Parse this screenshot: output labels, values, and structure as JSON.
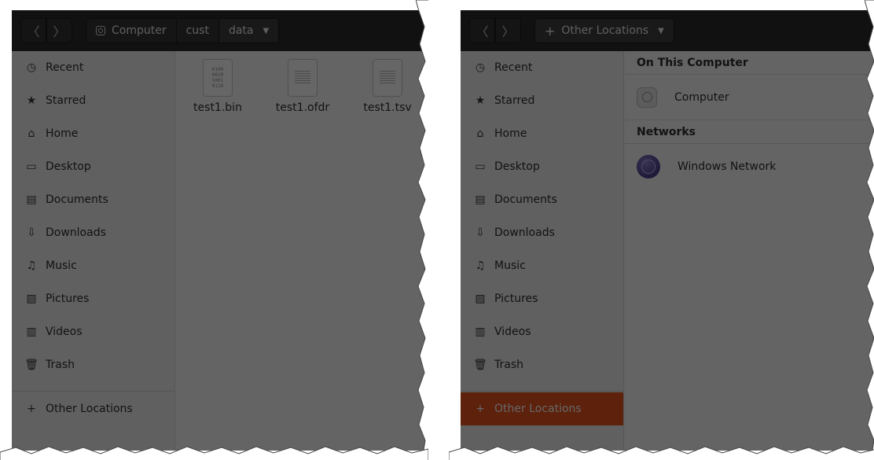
{
  "left": {
    "nav": {
      "back_glyph": "〈",
      "forward_glyph": "〉"
    },
    "breadcrumbs": [
      {
        "label": "Computer",
        "icon": "drive-icon"
      },
      {
        "label": "cust"
      },
      {
        "label": "data",
        "dropdown": true
      }
    ],
    "sidebar": {
      "items": [
        {
          "label": "Recent",
          "icon": "clock-icon",
          "glyph": "◷"
        },
        {
          "label": "Starred",
          "icon": "star-icon",
          "glyph": "★"
        },
        {
          "label": "Home",
          "icon": "home-icon",
          "glyph": "⌂"
        },
        {
          "label": "Desktop",
          "icon": "desktop-icon",
          "glyph": "▭"
        },
        {
          "label": "Documents",
          "icon": "document-icon",
          "glyph": "▤"
        },
        {
          "label": "Downloads",
          "icon": "download-icon",
          "glyph": "⇩"
        },
        {
          "label": "Music",
          "icon": "music-icon",
          "glyph": "♫"
        },
        {
          "label": "Pictures",
          "icon": "picture-icon",
          "glyph": "▨"
        },
        {
          "label": "Videos",
          "icon": "video-icon",
          "glyph": "▥"
        },
        {
          "label": "Trash",
          "icon": "trash-icon",
          "glyph": "🗑"
        }
      ],
      "other_locations": {
        "label": "Other Locations",
        "glyph": "+"
      }
    },
    "files": [
      {
        "name": "test1.bin",
        "type": "binary",
        "icon_text": "0100\n0010\n1001\n0110"
      },
      {
        "name": "test1.ofdr",
        "type": "text"
      },
      {
        "name": "test1.tsv",
        "type": "text"
      }
    ]
  },
  "right": {
    "nav": {
      "back_glyph": "〈",
      "forward_glyph": "〉"
    },
    "location_button": {
      "label": "Other Locations",
      "glyph": "+"
    },
    "sidebar": {
      "items": [
        {
          "label": "Recent",
          "glyph": "◷"
        },
        {
          "label": "Starred",
          "glyph": "★"
        },
        {
          "label": "Home",
          "glyph": "⌂"
        },
        {
          "label": "Desktop",
          "glyph": "▭"
        },
        {
          "label": "Documents",
          "glyph": "▤"
        },
        {
          "label": "Downloads",
          "glyph": "⇩"
        },
        {
          "label": "Music",
          "glyph": "♫"
        },
        {
          "label": "Pictures",
          "glyph": "▨"
        },
        {
          "label": "Videos",
          "glyph": "▥"
        },
        {
          "label": "Trash",
          "glyph": "🗑"
        }
      ],
      "other_locations": {
        "label": "Other Locations",
        "glyph": "+",
        "selected": true
      }
    },
    "sections": {
      "on_this_computer": {
        "heading": "On This Computer",
        "items": [
          {
            "label": "Computer",
            "icon": "hard-disk-icon"
          }
        ]
      },
      "networks": {
        "heading": "Networks",
        "items": [
          {
            "label": "Windows Network",
            "icon": "network-globe-icon"
          }
        ]
      }
    }
  },
  "colors": {
    "accent": "#e95420",
    "headerbar": "#2c2c2c",
    "sidebar": "#f0f0f0"
  }
}
